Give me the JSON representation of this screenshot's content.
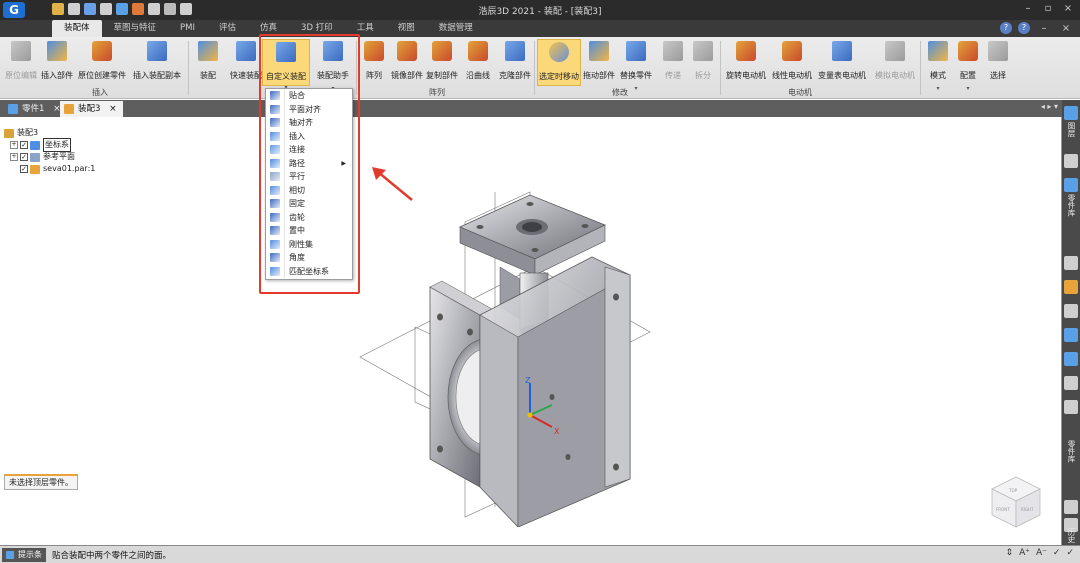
{
  "window": {
    "title": "浩辰3D 2021 - 装配 - [装配3]",
    "logo": "G",
    "controls": [
      "–",
      "▫",
      "×"
    ]
  },
  "qat_icon_colors": [
    "#e0b34a",
    "#cfcfcf",
    "#6aa0e8",
    "#cfcfcf",
    "#5aa0e6",
    "#e07a3a",
    "#cfcfcf",
    "#bbbbbb",
    "#cfcfcf"
  ],
  "tabs": [
    "装配体",
    "草图与特征",
    "PMI",
    "评估",
    "仿真",
    "3D 打印",
    "工具",
    "视图",
    "数据管理"
  ],
  "active_tab": "装配体",
  "help_icons": [
    "?",
    "?",
    "–",
    "×"
  ],
  "ribbon": {
    "buttons": [
      {
        "label": "原位编辑",
        "disabled": true,
        "shape": "shp-gray"
      },
      {
        "label": "插入部件",
        "disabled": false,
        "shape": "shp-a"
      },
      {
        "label": "原位创建零件",
        "disabled": false,
        "shape": "shp-b"
      },
      {
        "label": "插入装配副本",
        "disabled": false,
        "shape": "shp-c"
      },
      {
        "label": "装配",
        "disabled": false,
        "shape": "shp-a"
      },
      {
        "label": "快速装配",
        "disabled": false,
        "shape": "shp-c"
      },
      {
        "label": "自定义装配",
        "disabled": false,
        "shape": "shp-c"
      },
      {
        "label": "装配助手",
        "disabled": false,
        "shape": "shp-c"
      },
      {
        "label": "阵列",
        "disabled": false,
        "shape": "shp-b"
      },
      {
        "label": "镜像部件",
        "disabled": false,
        "shape": "shp-b"
      },
      {
        "label": "复制部件",
        "disabled": false,
        "shape": "shp-b"
      },
      {
        "label": "沿曲线",
        "disabled": false,
        "shape": "shp-b"
      },
      {
        "label": "克隆部件",
        "disabled": false,
        "shape": "shp-c"
      },
      {
        "label": "选定时移动",
        "disabled": false,
        "shape": "shp-d"
      },
      {
        "label": "拖动部件",
        "disabled": false,
        "shape": "shp-a"
      },
      {
        "label": "替换零件",
        "disabled": false,
        "shape": "shp-c"
      },
      {
        "label": "传递",
        "disabled": true,
        "shape": "shp-gray"
      },
      {
        "label": "拆分",
        "disabled": true,
        "shape": "shp-gray"
      },
      {
        "label": "旋转电动机",
        "disabled": false,
        "shape": "shp-b"
      },
      {
        "label": "线性电动机",
        "disabled": false,
        "shape": "shp-b"
      },
      {
        "label": "变量表电动机",
        "disabled": false,
        "shape": "shp-c"
      },
      {
        "label": "模拟电动机",
        "disabled": true,
        "shape": "shp-gray"
      },
      {
        "label": "模式",
        "disabled": false,
        "shape": "shp-a"
      },
      {
        "label": "配置",
        "disabled": false,
        "shape": "shp-b"
      },
      {
        "label": "选择",
        "disabled": false,
        "shape": "shp-gray"
      }
    ],
    "groups": [
      "插入",
      "阵列",
      "修改",
      "电动机"
    ]
  },
  "doc_tabs": [
    {
      "label": "零件1",
      "close": "×"
    },
    {
      "label": "装配3",
      "close": "×"
    }
  ],
  "doc_nav": "◂ ▸ ▾",
  "tree": {
    "items": [
      {
        "label": "装配3",
        "level": 0,
        "expander": "",
        "checkbox": false,
        "icon_color": "#d9a23a",
        "boxed": false
      },
      {
        "label": "坐标系",
        "level": 1,
        "expander": "+",
        "checkbox": true,
        "icon_color": "#4f8ee0",
        "boxed": true
      },
      {
        "label": "参考平面",
        "level": 1,
        "expander": "+",
        "checkbox": true,
        "icon_color": "#8aa4c8",
        "boxed": false
      },
      {
        "label": "seva01.par:1",
        "level": 1,
        "expander": "",
        "checkbox": true,
        "icon_color": "#e8a33b",
        "boxed": false
      }
    ]
  },
  "status_pill": "未选择顶层零件。",
  "menu": {
    "items": [
      {
        "label": "贴合",
        "color": "#3b6ac0",
        "submenu": false
      },
      {
        "label": "平面对齐",
        "color": "#3b6ac0",
        "submenu": false
      },
      {
        "label": "轴对齐",
        "color": "#3b6ac0",
        "submenu": false
      },
      {
        "label": "插入",
        "color": "#4f8ee0",
        "submenu": false
      },
      {
        "label": "连接",
        "color": "#5a9ae6",
        "submenu": false
      },
      {
        "label": "路径",
        "color": "#4f8ee0",
        "submenu": true
      },
      {
        "label": "平行",
        "color": "#8aa4c8",
        "submenu": false
      },
      {
        "label": "相切",
        "color": "#4f8ee0",
        "submenu": false
      },
      {
        "label": "固定",
        "color": "#3b6ac0",
        "submenu": false
      },
      {
        "label": "齿轮",
        "color": "#3b6ac0",
        "submenu": false
      },
      {
        "label": "置中",
        "color": "#3b6ac0",
        "submenu": false
      },
      {
        "label": "刚性集",
        "color": "#4f8ee0",
        "submenu": false
      },
      {
        "label": "角度",
        "color": "#3b6ac0",
        "submenu": false
      },
      {
        "label": "匹配坐标系",
        "color": "#4f8ee0",
        "submenu": false
      }
    ],
    "submenu_arrow": "▶"
  },
  "annotation_color": "#e23a2c",
  "triad": {
    "x": "X",
    "z": "Z"
  },
  "viewcube": {
    "faces": [
      "FRONT",
      "RIGHT",
      "TOP"
    ]
  },
  "right_sidebar": {
    "labels": [
      "图层",
      "零件库",
      "零件库",
      "历史"
    ]
  },
  "prompt": {
    "label": "提示条",
    "text": "贴合装配中两个零件之间的面。",
    "tools": [
      "⇕",
      "A⁺",
      "A⁻",
      "✓",
      "✓"
    ]
  }
}
